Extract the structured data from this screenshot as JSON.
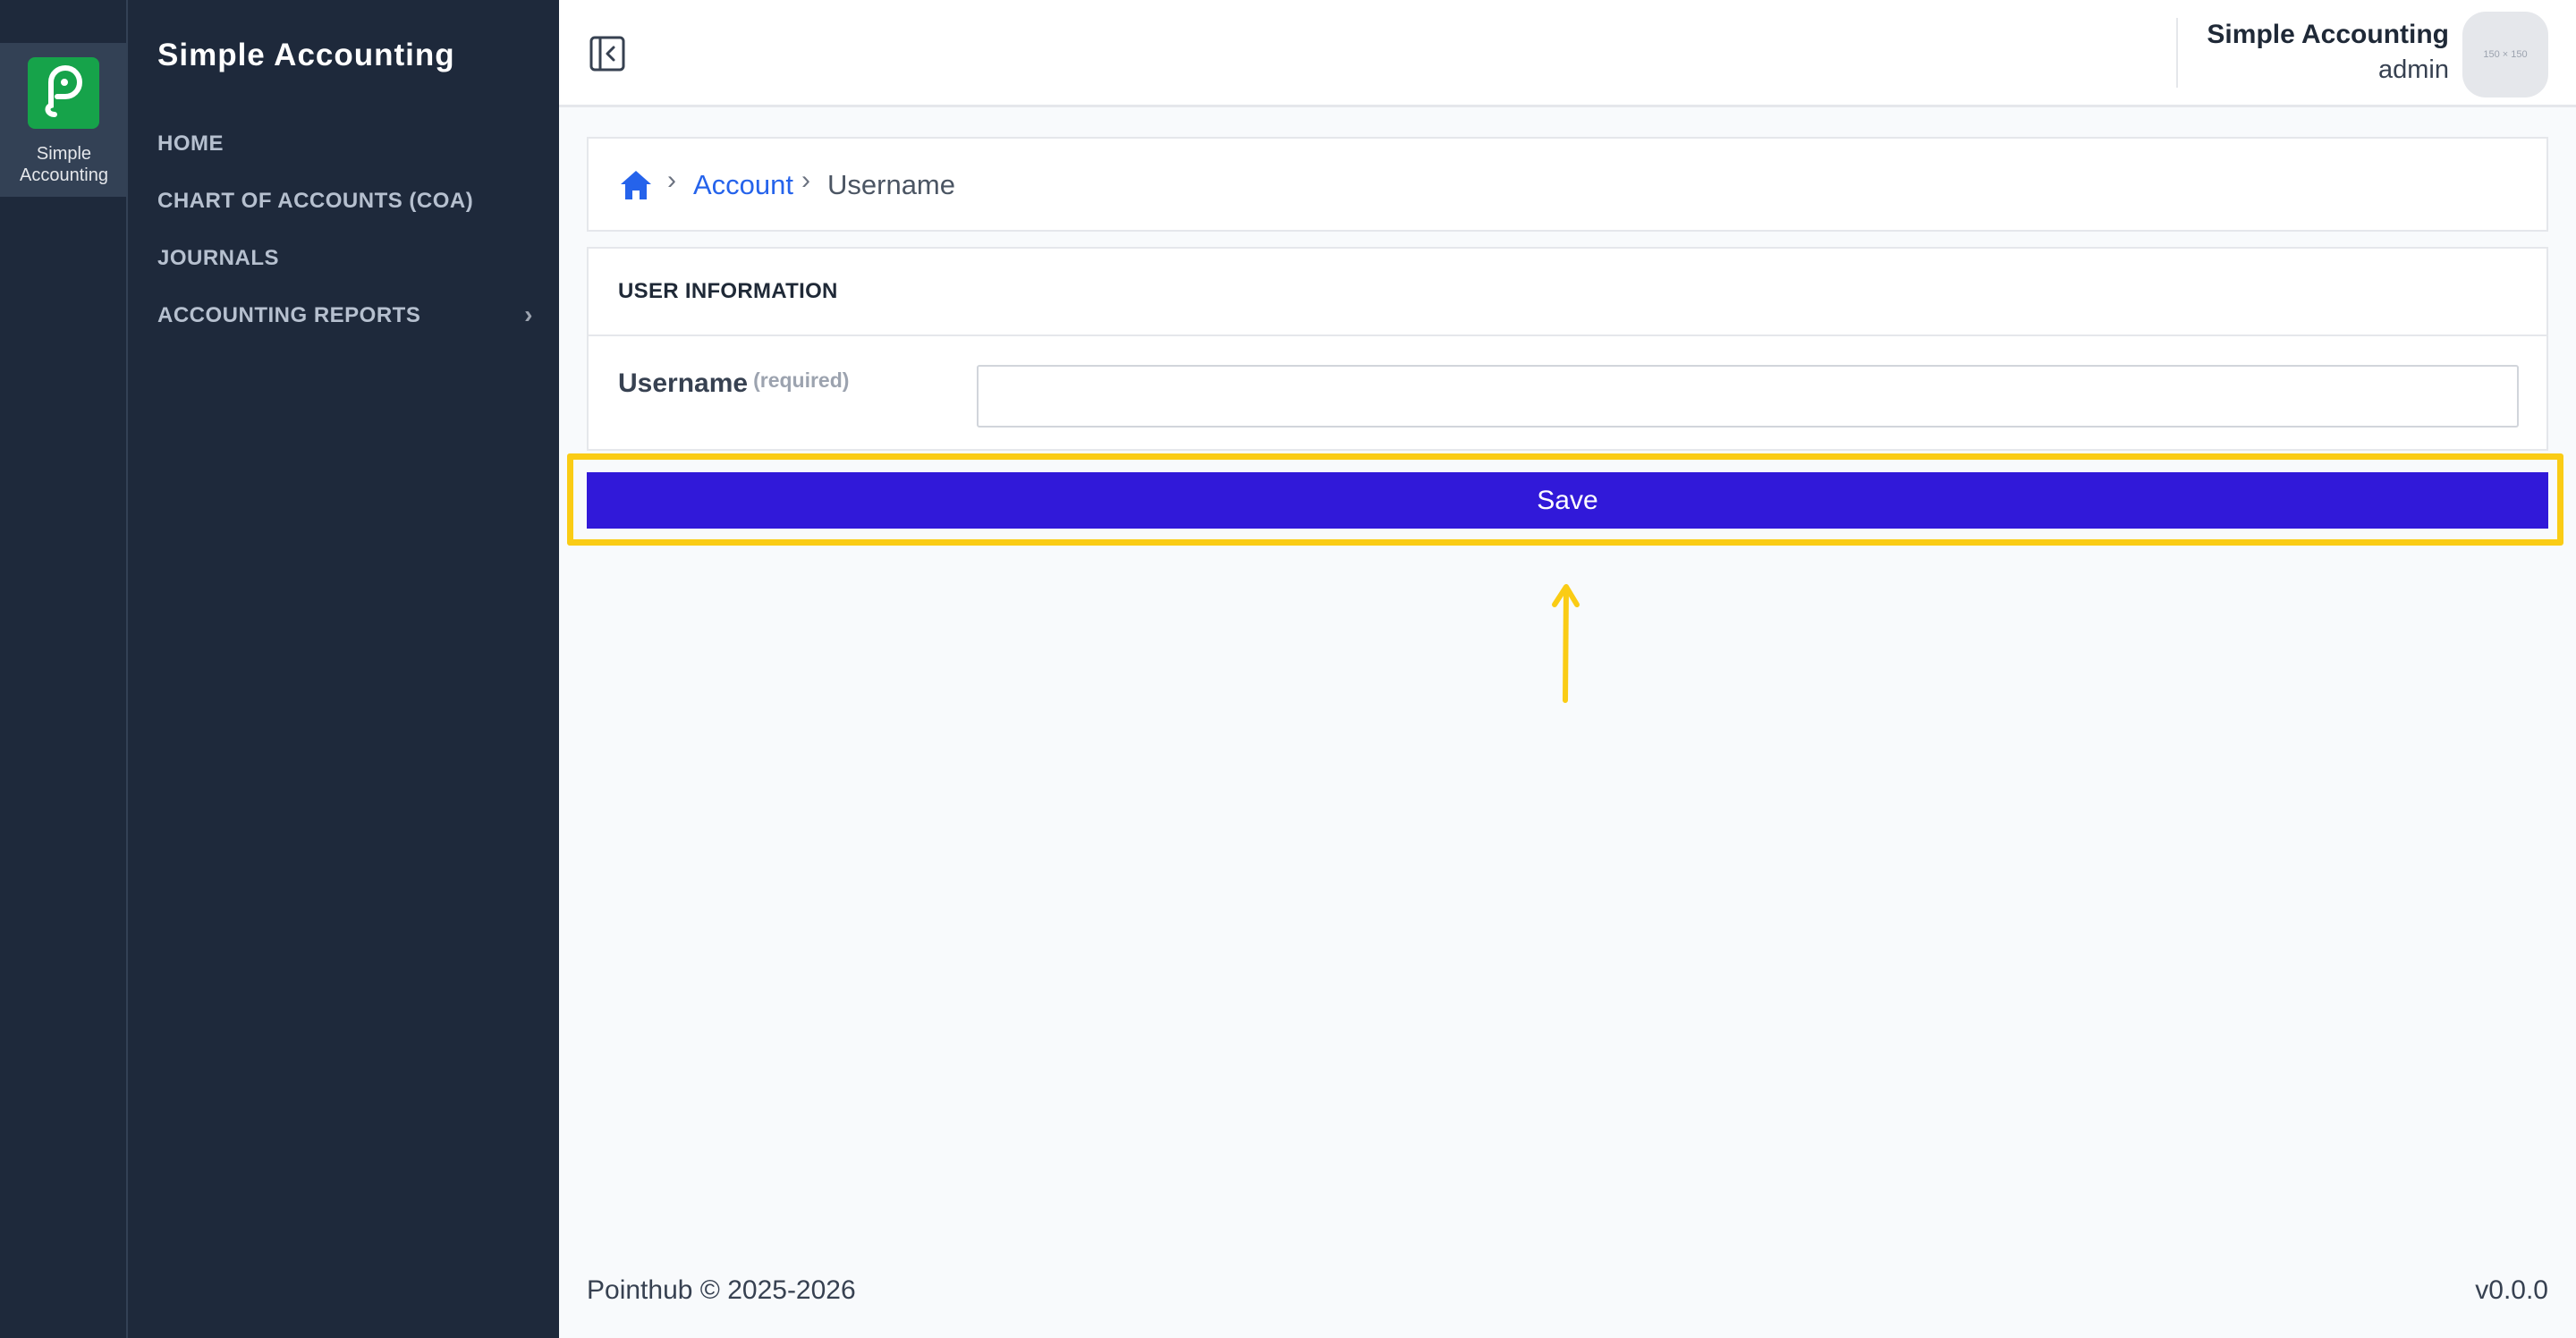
{
  "rail": {
    "app_label": "Simple Accounting"
  },
  "sidebar": {
    "title": "Simple Accounting",
    "items": [
      {
        "label": "HOME"
      },
      {
        "label": "CHART OF ACCOUNTS (COA)"
      },
      {
        "label": "JOURNALS"
      },
      {
        "label": "ACCOUNTING REPORTS",
        "has_submenu": true
      }
    ]
  },
  "header": {
    "user_name": "Simple Accounting",
    "user_role": "admin",
    "avatar_text": "150 × 150"
  },
  "breadcrumb": {
    "items": [
      {
        "label": "Account"
      },
      {
        "label": "Username"
      }
    ]
  },
  "form": {
    "section_title": "USER INFORMATION",
    "username_label": "Username",
    "username_required": "(required)",
    "username_value": "",
    "save_label": "Save"
  },
  "footer": {
    "copyright": "Pointhub © 2025-2026",
    "version": "v0.0.0"
  },
  "colors": {
    "sidebar_bg": "#1e293b",
    "logo_green": "#16a34a",
    "primary_button": "#3119d9",
    "link_blue": "#2563eb",
    "highlight_yellow": "#facc15"
  }
}
